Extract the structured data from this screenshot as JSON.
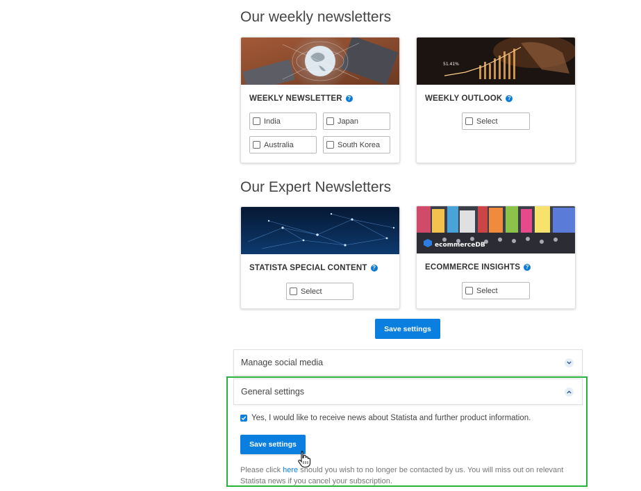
{
  "weekly": {
    "heading": "Our weekly newsletters",
    "cards": [
      {
        "title": "WEEKLY NEWSLETTER",
        "help": "?",
        "options": [
          "India",
          "Japan",
          "Australia",
          "South Korea"
        ]
      },
      {
        "title": "WEEKLY OUTLOOK",
        "help": "?",
        "image_text": [
          "51.41%"
        ],
        "options": [
          "Select"
        ]
      }
    ]
  },
  "expert": {
    "heading": "Our Expert Newsletters",
    "cards": [
      {
        "title": "STATISTA SPECIAL CONTENT",
        "help": "?",
        "options": [
          "Select"
        ]
      },
      {
        "title": "ECOMMERCE INSIGHTS",
        "help": "?",
        "image_logo": "ecommerceDB",
        "options": [
          "Select"
        ]
      }
    ],
    "save_label": "Save settings"
  },
  "accordions": [
    {
      "label": "Manage social media",
      "expanded": false
    },
    {
      "label": "General settings",
      "expanded": true
    }
  ],
  "general": {
    "consent_label": "Yes, I would like to receive news about Statista and further product information.",
    "consent_checked": true,
    "save_label": "Save settings",
    "info_before": "Please click ",
    "info_link": "here",
    "info_after": " should you wish to no longer be contacted by us. You will miss out on relevant Statista news if you cancel your subscription."
  },
  "colors": {
    "accent": "#0b7fe0",
    "highlight_frame": "#27b33a"
  }
}
